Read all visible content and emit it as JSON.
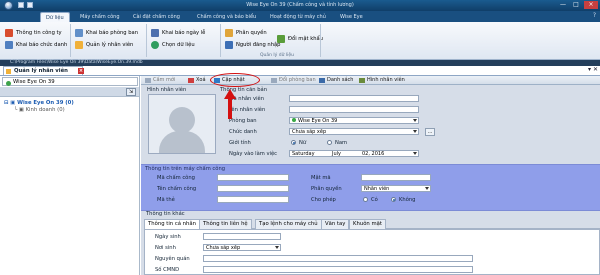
{
  "window": {
    "title": "Wise Eye On 39 (Chấm công và tính lương)"
  },
  "ribbon_tabs": [
    "Dữ liệu",
    "Máy chấm công",
    "Cài đặt chấm công",
    "Chấm công và báo biểu",
    "Hoạt động từ máy chủ",
    "Wise Eye"
  ],
  "ribbon_buttons": {
    "g1": [
      "Thông tin công ty",
      "Khai báo chức danh"
    ],
    "g2": [
      "Khai báo phòng ban",
      "Quản lý nhân viên"
    ],
    "g3": [
      "Khai báo ngày lễ",
      "Chọn dữ liệu"
    ],
    "g4": [
      "Phân quyền",
      "Người đăng nhập"
    ],
    "g5": [
      "Đổi mật khẩu"
    ]
  },
  "ribbon_group_label": "Quản lý dữ liệu",
  "path": "C:\\Program Files\\Wise Eye On 39\\Data\\WiseEye.On.39.mdb",
  "doc_tab": "Quản lý nhân viên",
  "left_header": "Wise Eye On 39",
  "tree": {
    "root": "Wise Eye On 39 (0)",
    "child": "Kinh doanh (0)"
  },
  "toolbar": [
    "Cấm mới",
    "Xoá",
    "Cập nhật",
    "Đổi phòng ban",
    "Danh sách",
    "Hình nhân viên"
  ],
  "photo_title": "Hình nhân viên",
  "basic": {
    "header": "Thông tin căn bản",
    "labels": [
      "Mã nhân viên",
      "Tên nhân viên",
      "Phòng ban",
      "Chức danh",
      "Giới tính",
      "Ngày vào làm việc"
    ],
    "department": "Wise Eye On 39",
    "title_value": "Chưa sắp xếp",
    "gender_female": "Nữ",
    "gender_male": "Nam",
    "date": {
      "weekday": "Saturday",
      "month": "July",
      "day": "02, 2016"
    }
  },
  "device": {
    "header": "Thông tin trên máy chấm công",
    "left_labels": [
      "Mã chấm công",
      "Tên chấm công",
      "Mã thẻ"
    ],
    "right_labels": [
      "Mật mã",
      "Phân quyền",
      "Cho phép"
    ],
    "role": "Nhân viên",
    "allow_yes": "Có",
    "allow_no": "Không"
  },
  "other": {
    "header": "Thông tin khác",
    "tabs": [
      "Thông tin cá nhân",
      "Thông tin liên hệ",
      "Tạo lệnh cho máy chủ",
      "Văn tay",
      "Khuôn mặt"
    ],
    "labels": [
      "Ngày sinh",
      "Nơi sinh",
      "Nguyên quán",
      "Số CMND"
    ],
    "birthplace": "Chưa sắp xếp"
  },
  "colors": {
    "accent": "#194f80",
    "device_panel": "#8f9eea",
    "highlight": "#d41010"
  }
}
